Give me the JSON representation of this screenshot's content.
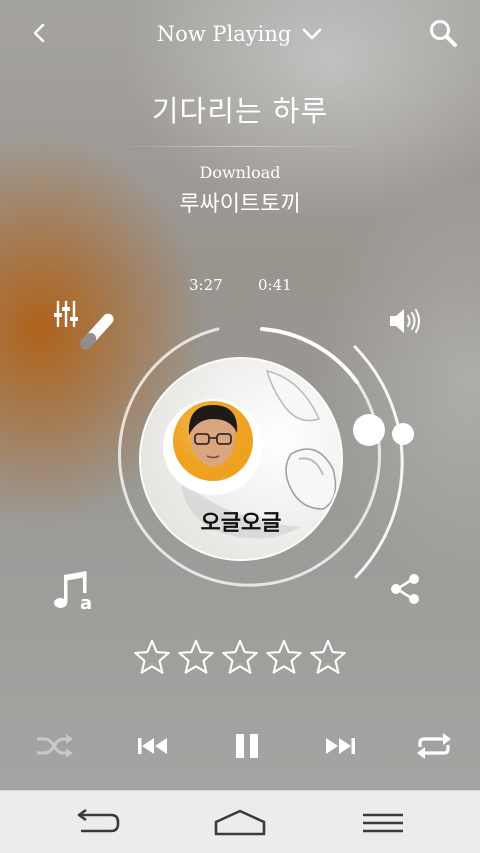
{
  "header": {
    "title": "Now Playing",
    "back_icon": "chevron-left-icon",
    "dropdown_icon": "chevron-down-icon",
    "search_icon": "search-icon"
  },
  "track": {
    "title": "기다리는 하루",
    "album_label": "Download",
    "artist": "루싸이트토끼",
    "total_time": "3:27",
    "elapsed_time": "0:41",
    "progress": 0.2,
    "volume": 0.7,
    "album_art_text": "오글오글"
  },
  "side_icons": {
    "equalizer": "equalizer-icon",
    "volume": "speaker-icon",
    "lyrics": "music-note-a-icon",
    "share": "share-icon"
  },
  "rating": {
    "value": 0,
    "max": 5
  },
  "playback": {
    "shuffle": "shuffle-icon",
    "previous": "previous-icon",
    "pause": "pause-icon",
    "next": "next-icon",
    "repeat": "repeat-icon"
  },
  "nav": {
    "back": "back-arrow-icon",
    "home": "home-icon",
    "menu": "menu-icon"
  },
  "colors": {
    "accent": "#ffffff",
    "nav_bg": "#ebecee",
    "nav_icon": "#3a3b3d",
    "disabled_icon": "#c8c8c8",
    "egg_yolk": "#f0a21e"
  }
}
